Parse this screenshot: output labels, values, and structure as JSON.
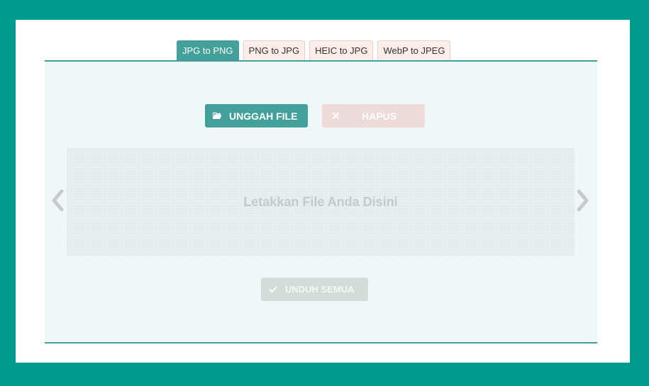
{
  "tabs": [
    {
      "label": "JPG to PNG",
      "active": true
    },
    {
      "label": "PNG to JPG",
      "active": false
    },
    {
      "label": "HEIC to JPG",
      "active": false
    },
    {
      "label": "WebP to JPEG",
      "active": false
    }
  ],
  "toolbar": {
    "upload_label": "UNGGAH FILE",
    "upload_icon": "folder-open-icon",
    "clear_label": "HAPUS",
    "clear_icon": "close-icon"
  },
  "dropzone": {
    "text": "Letakkan File Anda Disini"
  },
  "carousel": {
    "prev_icon": "chevron-left-icon",
    "next_icon": "chevron-right-icon"
  },
  "download_all": {
    "label": "UNDUH SEMUA",
    "icon": "check-icon"
  },
  "colors": {
    "background": "#009B8F",
    "accent": "#44A09B",
    "tab_inactive": "#FDEEEA",
    "panel": "#EFF8F8",
    "clear_button": "#EEDAD6",
    "download_disabled": "#D3DCDB"
  }
}
